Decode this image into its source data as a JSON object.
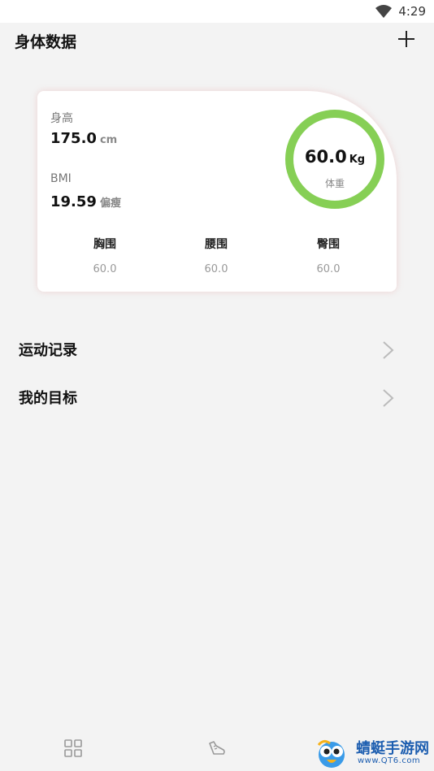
{
  "status_bar": {
    "time": "4:29",
    "wifi_icon": "wifi-icon"
  },
  "header": {
    "title": "身体数据",
    "add_icon": "plus-icon"
  },
  "card": {
    "height": {
      "label": "身高",
      "value": "175.0",
      "unit": "cm"
    },
    "bmi": {
      "label": "BMI",
      "value": "19.59",
      "status": "偏瘦"
    },
    "weight": {
      "value": "60.0",
      "unit": "Kg",
      "label": "体重"
    },
    "measures": [
      {
        "name": "胸围",
        "value": "60.0"
      },
      {
        "name": "腰围",
        "value": "60.0"
      },
      {
        "name": "臀围",
        "value": "60.0"
      }
    ],
    "ring_color": "#86cf55"
  },
  "menu": [
    {
      "label": "运动记录"
    },
    {
      "label": "我的目标"
    }
  ],
  "bottom_nav": {
    "icons": [
      "grid-icon",
      "sneaker-icon"
    ]
  },
  "watermark": {
    "text": "蜻蜓手游网",
    "url": "www.QT6.com"
  }
}
